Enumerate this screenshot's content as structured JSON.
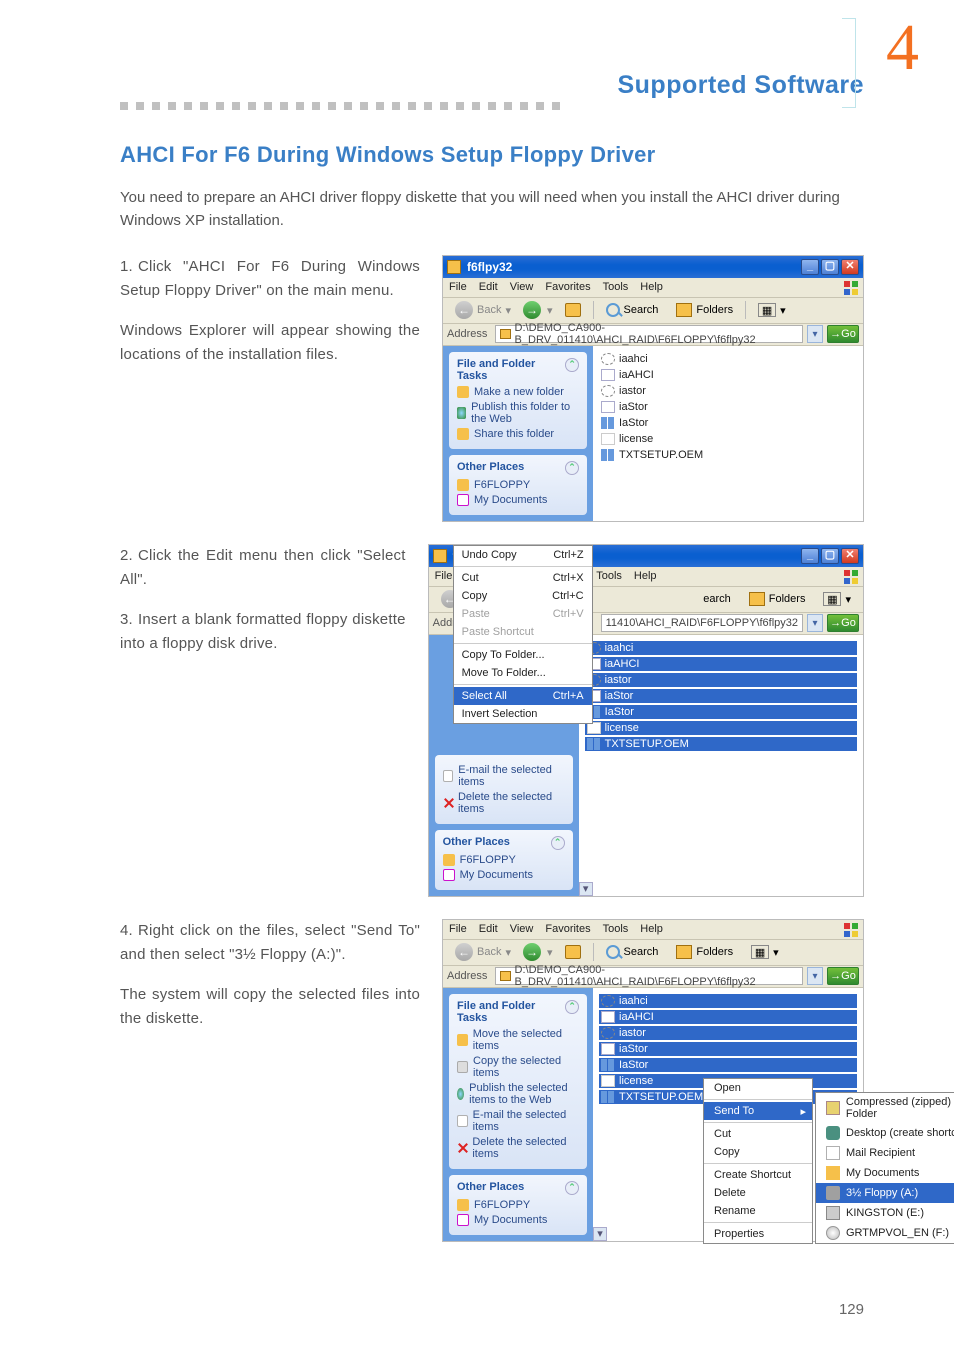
{
  "chapter_number": "4",
  "header_title": "Supported Software",
  "section_title": "AHCI For F6 During Windows Setup Floppy Driver",
  "intro": "You need to prepare an AHCI driver floppy diskette that you will need when you install the AHCI driver during Windows XP installation.",
  "page_number": "129",
  "steps": {
    "s1a": "Click \"AHCI For F6 During Windows Setup Floppy Driver\" on the main menu.",
    "s1b": "Windows Explorer will appear showing the locations of the installation files.",
    "s2": "Click the Edit menu then click \"Select All\".",
    "s3": "Insert a blank formatted floppy diskette into a floppy disk drive.",
    "s4a": "Right click on the files, select \"Send To\" and then select \"3½ Floppy (A:)\".",
    "s4b": "The system will copy the selected files into the diskette."
  },
  "win": {
    "title": "f6flpy32",
    "menus": [
      "File",
      "Edit",
      "View",
      "Favorites",
      "Tools",
      "Help"
    ],
    "tb": {
      "back": "Back",
      "search": "Search",
      "folders": "Folders"
    },
    "addr_label": "Address",
    "addr_path": "D:\\DEMO_CA900-B_DRV_011410\\AHCI_RAID\\F6FLOPPY\\f6flpy32",
    "addr_path2": "11410\\AHCI_RAID\\F6FLOPPY\\f6flpy32",
    "go": "Go",
    "task1_hdr": "File and Folder Tasks",
    "task1": [
      "Make a new folder",
      "Publish this folder to the Web",
      "Share this folder"
    ],
    "task1_sel": [
      "Move the selected items",
      "Copy the selected items",
      "Publish the selected items to the Web",
      "E-mail the selected items",
      "Delete the selected items"
    ],
    "task2_hdr": "Other Places",
    "task2": [
      "F6FLOPPY",
      "My Documents"
    ],
    "files": [
      "iaahci",
      "iaAHCI",
      "iastor",
      "iaStor",
      "IaStor",
      "license",
      "TXTSETUP.OEM"
    ],
    "edit_menu": [
      {
        "l": "Undo Copy",
        "r": "Ctrl+Z",
        "d": false
      },
      {
        "sep": true
      },
      {
        "l": "Cut",
        "r": "Ctrl+X",
        "d": false
      },
      {
        "l": "Copy",
        "r": "Ctrl+C",
        "d": false
      },
      {
        "l": "Paste",
        "r": "Ctrl+V",
        "d": true
      },
      {
        "l": "Paste Shortcut",
        "r": "",
        "d": true
      },
      {
        "sep": true
      },
      {
        "l": "Copy To Folder...",
        "r": "",
        "d": false
      },
      {
        "l": "Move To Folder...",
        "r": "",
        "d": false
      },
      {
        "sep": true
      },
      {
        "l": "Select All",
        "r": "Ctrl+A",
        "d": false,
        "sel": true
      },
      {
        "l": "Invert Selection",
        "r": "",
        "d": false
      }
    ],
    "ctx": [
      "Open",
      "Send To",
      "Cut",
      "Copy",
      "Create Shortcut",
      "Delete",
      "Rename",
      "Properties"
    ],
    "sendto": [
      "Compressed (zipped) Folder",
      "Desktop (create shortcut)",
      "Mail Recipient",
      "My Documents",
      "3½ Floppy (A:)",
      "KINGSTON (E:)",
      "GRTMPVOL_EN (F:)"
    ]
  }
}
